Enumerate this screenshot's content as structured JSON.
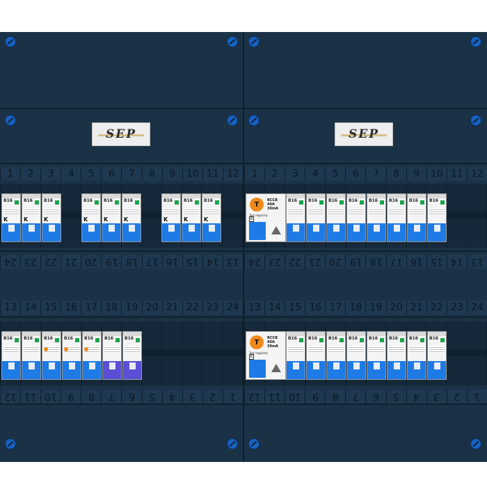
{
  "board": {
    "brand_logo_text": "SEP",
    "colors": {
      "panel": "#1b3246",
      "breaker_blue": "#1e7be6",
      "rcd_orange": "#f08a1c",
      "screw_blue": "#1762c0"
    },
    "top_numbers": [
      "1",
      "2",
      "3",
      "4",
      "5",
      "6",
      "7",
      "8",
      "9",
      "10",
      "11",
      "12"
    ],
    "mid_numbers_reversed": [
      "24",
      "23",
      "22",
      "21",
      "20",
      "19",
      "18",
      "17",
      "16",
      "15",
      "14",
      "13"
    ],
    "lower_numbers": [
      "13",
      "14",
      "15",
      "16",
      "17",
      "18",
      "19",
      "20",
      "21",
      "22",
      "23",
      "24"
    ],
    "bottom_numbers_reversed": [
      "12",
      "11",
      "10",
      "9",
      "8",
      "7",
      "6",
      "5",
      "4",
      "3",
      "2",
      "1"
    ],
    "breaker_rating": "B16",
    "breaker_mark": "K",
    "rcd_badge": "T",
    "rcd_test_text": "Test regularly",
    "rcd_spec_line1": "RCCB",
    "rcd_spec_line2": "40A",
    "rcd_spec_line3": "30mA"
  }
}
